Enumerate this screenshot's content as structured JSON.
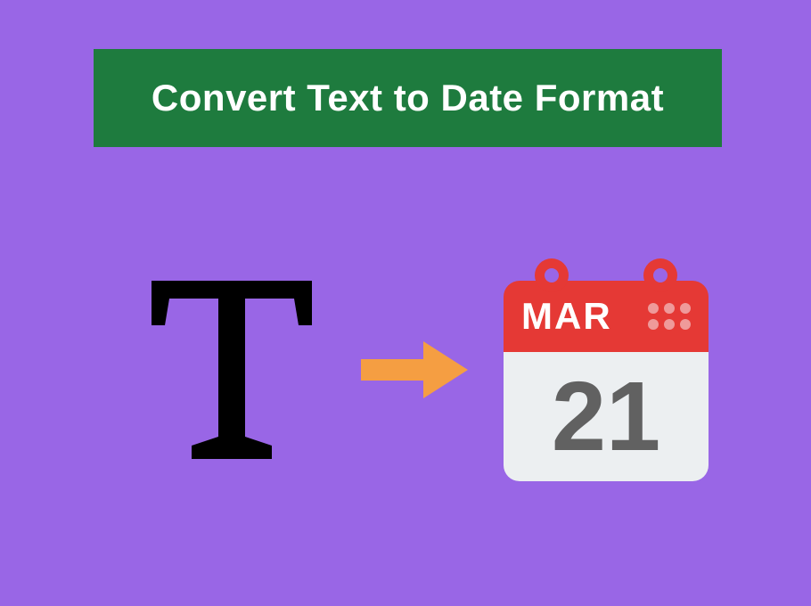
{
  "title": "Convert Text to Date Format",
  "calendar": {
    "month": "MAR",
    "day": "21"
  },
  "colors": {
    "background": "#9966e6",
    "banner": "#1e7b3e",
    "arrow": "#f59e42",
    "calHeader": "#e53935",
    "calBody": "#eceff1",
    "calDay": "#616161"
  }
}
